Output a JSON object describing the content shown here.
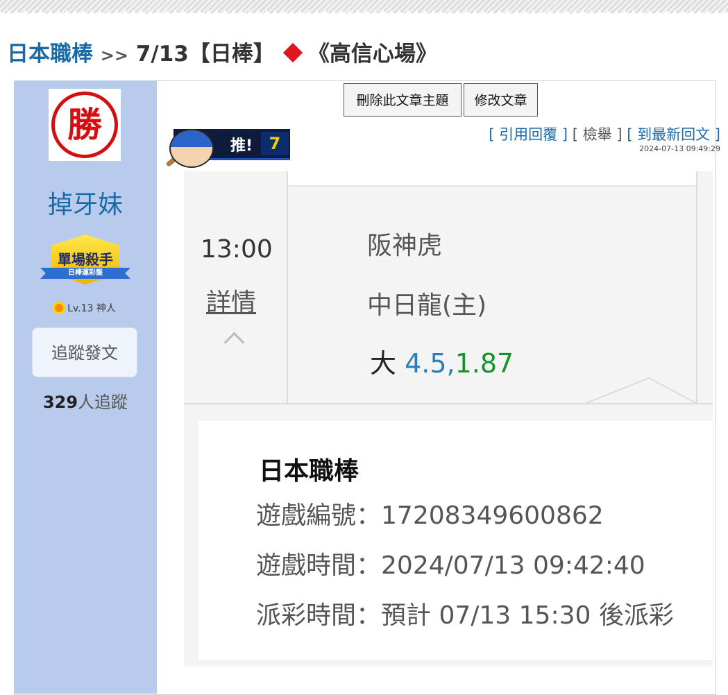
{
  "breadcrumb": {
    "category": "日本職棒",
    "separator": ">>",
    "title_prefix": "7/13【日棒】",
    "title_suffix": "《高信心場》"
  },
  "user": {
    "avatar_char": "勝",
    "name": "掉牙妹",
    "badge_title": "單場殺手",
    "badge_subtitle": "日棒運彩盤",
    "level": "Lv.13 神人",
    "follow_button": "追蹤發文",
    "followers_count": "329",
    "followers_label": "人追蹤"
  },
  "toolbar": {
    "delete_label": "刪除此文章主題",
    "edit_label": "修改文章"
  },
  "push": {
    "label": "推!",
    "count": "7"
  },
  "actions": {
    "quote_reply": "引用回覆",
    "report": "檢舉",
    "latest_reply": "到最新回文"
  },
  "post_timestamp": "2024-07-13 09:49:29",
  "game": {
    "time": "13:00",
    "detail_link": "詳情",
    "team_away": "阪神虎",
    "team_home": "中日龍(主)",
    "pick_side": "大",
    "pick_line": "4.5,",
    "pick_odds": "1.87"
  },
  "info": {
    "league": "日本職棒",
    "game_id_label": "遊戲編號：",
    "game_id": "17208349600862",
    "game_time_label": "遊戲時間：",
    "game_time": "2024/07/13 09:42:40",
    "payout_label": "派彩時間：",
    "payout_time": "預計 07/13 15:30 後派彩"
  },
  "colors": {
    "link_blue": "#1a6aa8",
    "sidebar_bg": "#b9cbec",
    "line_blue": "#2b7fb8",
    "odds_green": "#13932a",
    "diamond_red": "#e0161f"
  }
}
